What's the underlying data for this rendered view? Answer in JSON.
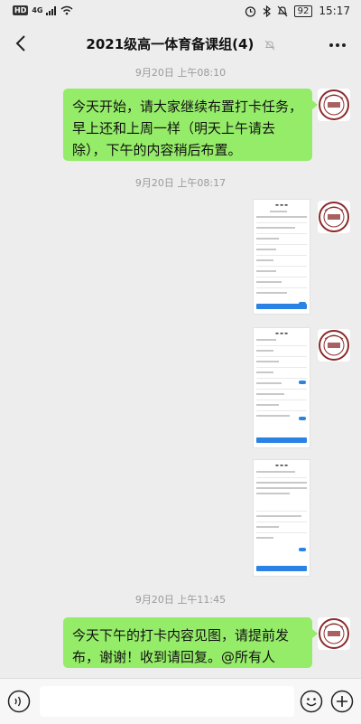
{
  "status": {
    "hd": "HD",
    "network": "4G",
    "battery": "92",
    "time": "15:17"
  },
  "header": {
    "title": "2021级高一体育备课组(4)",
    "back_icon": "chevron-left-icon",
    "mute_icon": "bell-off-icon",
    "more_icon": "more-horizontal-icon"
  },
  "messages": [
    {
      "timestamp": "9月20日 上午08:10",
      "text": "今天开始，请大家继续布置打卡任务，早上还和上周一样（明天上午请去除），下午的内容稍后布置。"
    },
    {
      "timestamp": "9月20日 上午08:17"
    },
    {
      "timestamp": "9月20日 上午11:45",
      "text": "今天下午的打卡内容见图，请提前发布，谢谢！收到请回复。@所有人"
    }
  ],
  "input": {
    "voice_icon": "voice-icon",
    "emoji_icon": "emoji-icon",
    "plus_icon": "plus-circle-icon"
  },
  "colors": {
    "bubble": "#95ec69",
    "background": "#ededed",
    "accent": "#2a82e4"
  }
}
